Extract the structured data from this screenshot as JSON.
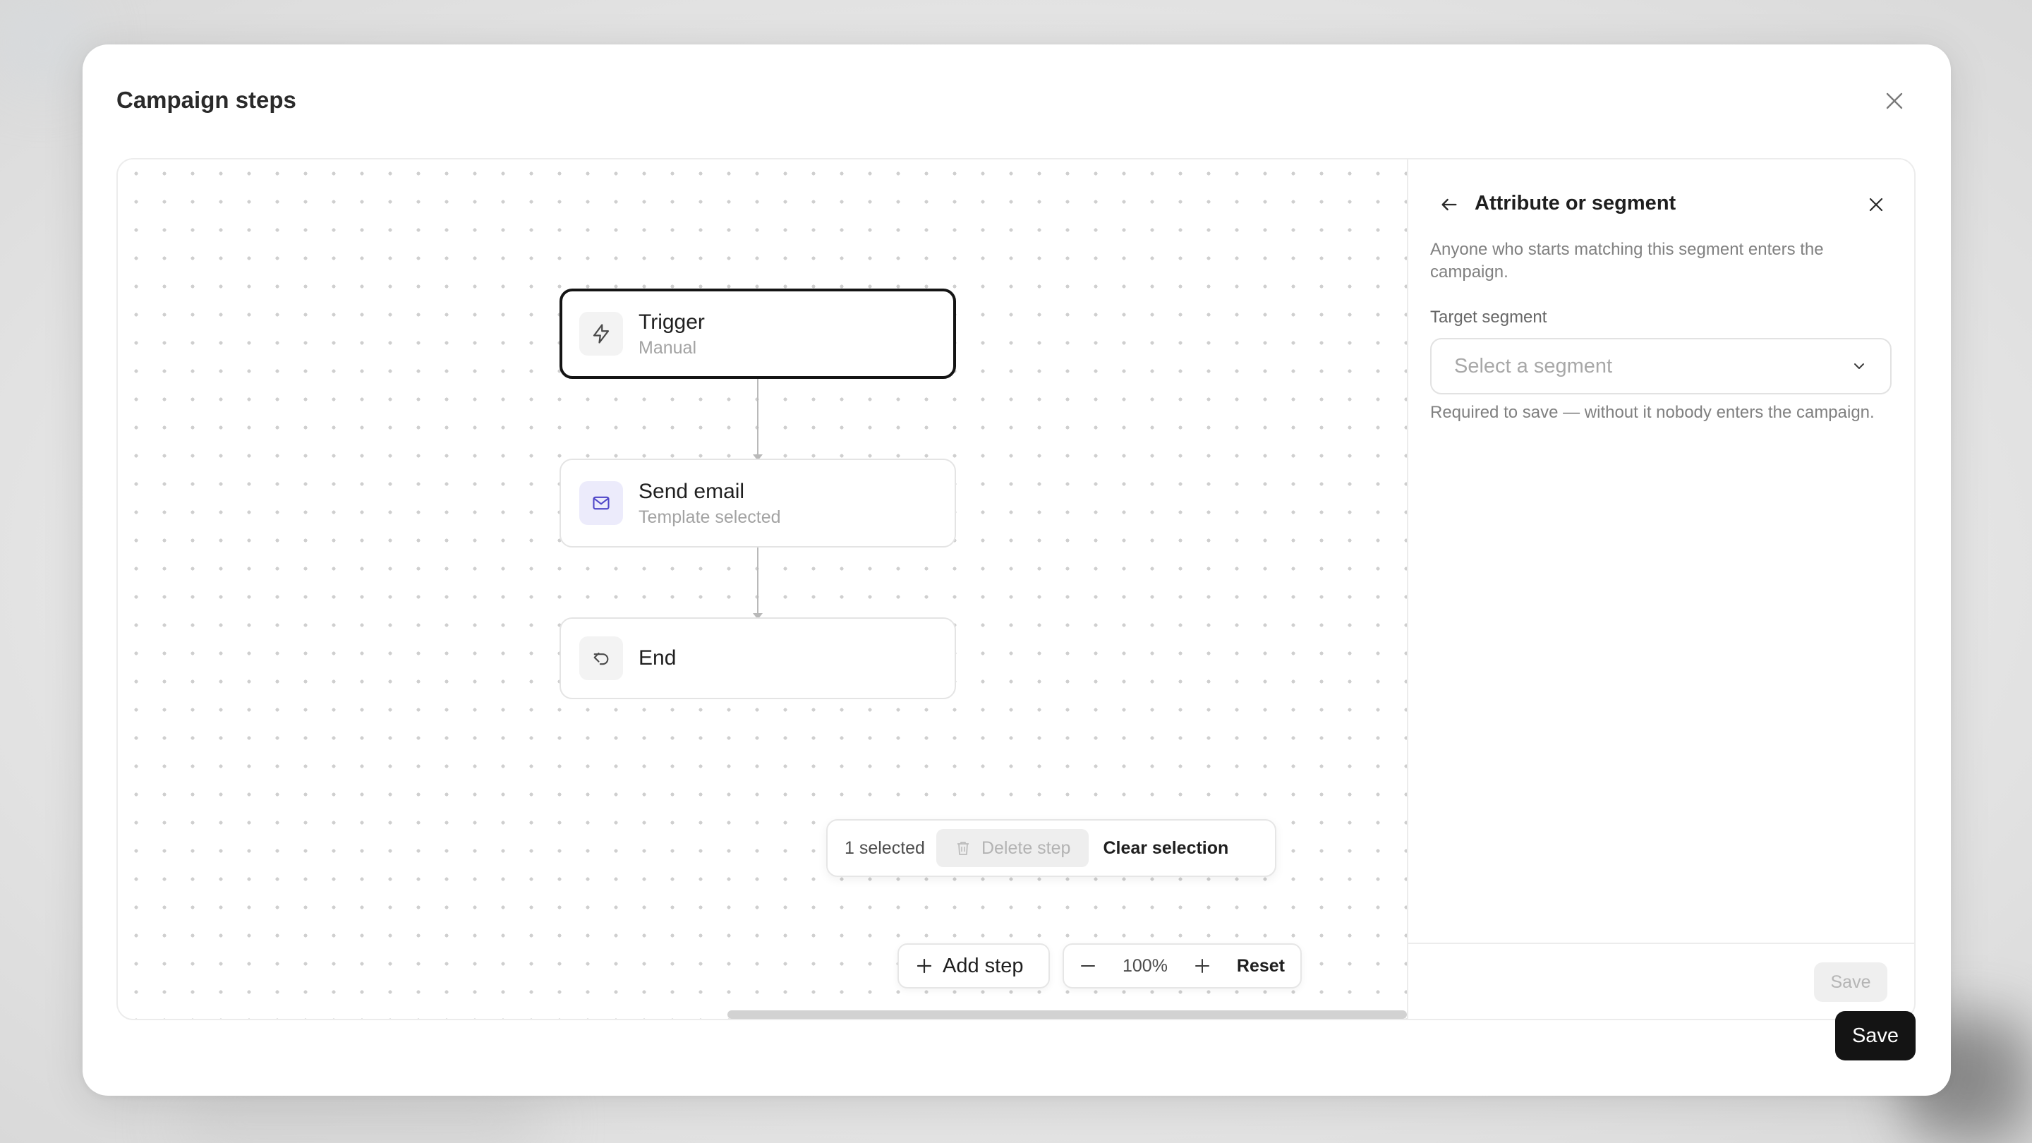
{
  "modal": {
    "title": "Campaign steps",
    "save_label": "Save"
  },
  "nodes": [
    {
      "title": "Trigger",
      "subtitle": "Manual",
      "icon": "lightning-icon",
      "selected": true
    },
    {
      "title": "Send email",
      "subtitle": "Template selected",
      "icon": "mail-icon"
    },
    {
      "title": "End",
      "subtitle": "",
      "icon": "return-icon"
    }
  ],
  "selection_bar": {
    "count": "1 selected",
    "delete_label": "Delete step",
    "clear_label": "Clear selection"
  },
  "toolbar": {
    "add_step": "Add step",
    "zoom": "100%",
    "reset": "Reset"
  },
  "panel": {
    "title": "Attribute or segment",
    "description": "Anyone who starts matching this segment enters the campaign.",
    "field_label": "Target segment",
    "select_placeholder": "Select a segment",
    "help": "Required to save — without it nobody enters the campaign.",
    "save_label": "Save"
  },
  "colors": {
    "primary": "#141414",
    "node_email_icon_bg": "#ecebfb",
    "email_icon": "#4f46c8"
  }
}
